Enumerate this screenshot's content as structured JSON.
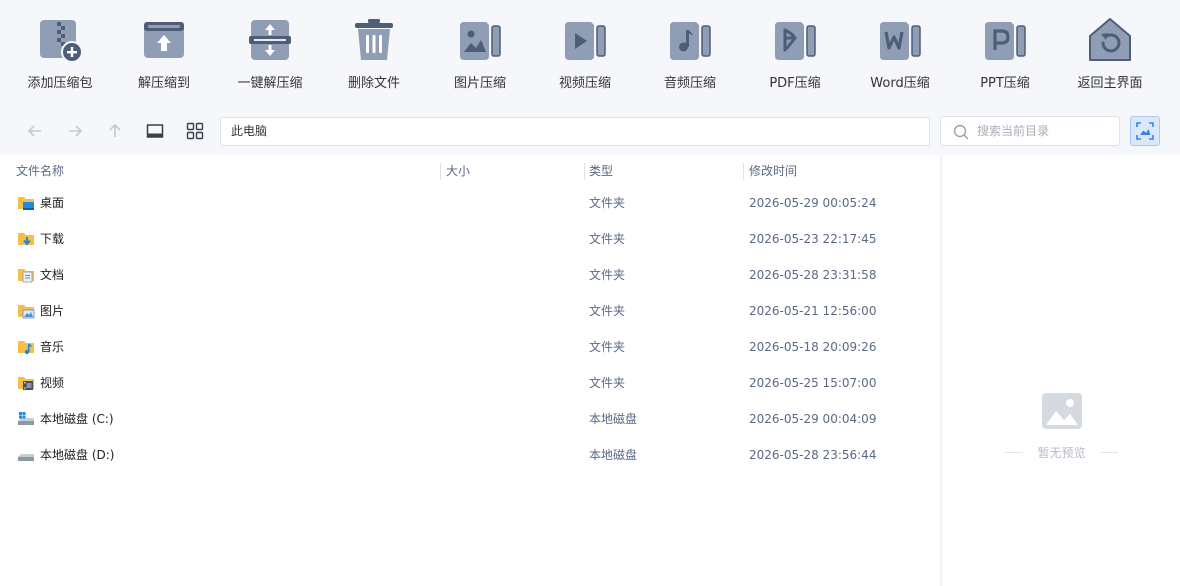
{
  "toolbar": {
    "items": [
      {
        "label": "添加压缩包",
        "icon": "add-archive-icon"
      },
      {
        "label": "解压缩到",
        "icon": "extract-to-icon"
      },
      {
        "label": "一键解压缩",
        "icon": "one-click-extract-icon"
      },
      {
        "label": "删除文件",
        "icon": "trash-icon"
      },
      {
        "label": "图片压缩",
        "icon": "image-compress-icon"
      },
      {
        "label": "视频压缩",
        "icon": "video-compress-icon"
      },
      {
        "label": "音频压缩",
        "icon": "audio-compress-icon"
      },
      {
        "label": "PDF压缩",
        "icon": "pdf-compress-icon"
      },
      {
        "label": "Word压缩",
        "icon": "word-compress-icon"
      },
      {
        "label": "PPT压缩",
        "icon": "ppt-compress-icon"
      },
      {
        "label": "返回主界面",
        "icon": "home-return-icon"
      }
    ]
  },
  "nav": {
    "path": "此电脑",
    "search_placeholder": "搜索当前目录"
  },
  "table": {
    "headers": {
      "name": "文件名称",
      "size": "大小",
      "type": "类型",
      "modified": "修改时间"
    },
    "rows": [
      {
        "name": "桌面",
        "size": "",
        "type": "文件夹",
        "modified": "2026-05-29 00:05:24",
        "icon": "desktop-folder-icon"
      },
      {
        "name": "下载",
        "size": "",
        "type": "文件夹",
        "modified": "2026-05-23 22:17:45",
        "icon": "downloads-folder-icon"
      },
      {
        "name": "文档",
        "size": "",
        "type": "文件夹",
        "modified": "2026-05-28 23:31:58",
        "icon": "documents-folder-icon"
      },
      {
        "name": "图片",
        "size": "",
        "type": "文件夹",
        "modified": "2026-05-21 12:56:00",
        "icon": "pictures-folder-icon"
      },
      {
        "name": "音乐",
        "size": "",
        "type": "文件夹",
        "modified": "2026-05-18 20:09:26",
        "icon": "music-folder-icon"
      },
      {
        "name": "视频",
        "size": "",
        "type": "文件夹",
        "modified": "2026-05-25 15:07:00",
        "icon": "videos-folder-icon"
      },
      {
        "name": "本地磁盘 (C:)",
        "size": "",
        "type": "本地磁盘",
        "modified": "2026-05-29 00:04:09",
        "icon": "system-drive-icon"
      },
      {
        "name": "本地磁盘 (D:)",
        "size": "",
        "type": "本地磁盘",
        "modified": "2026-05-28 23:56:44",
        "icon": "drive-icon"
      }
    ]
  },
  "preview": {
    "empty_text": "暂无预览"
  },
  "colors": {
    "icon_fill": "#8f9db5",
    "icon_dark": "#4f5d78",
    "accent": "#3b82e0",
    "folder": "#f5c04a"
  }
}
